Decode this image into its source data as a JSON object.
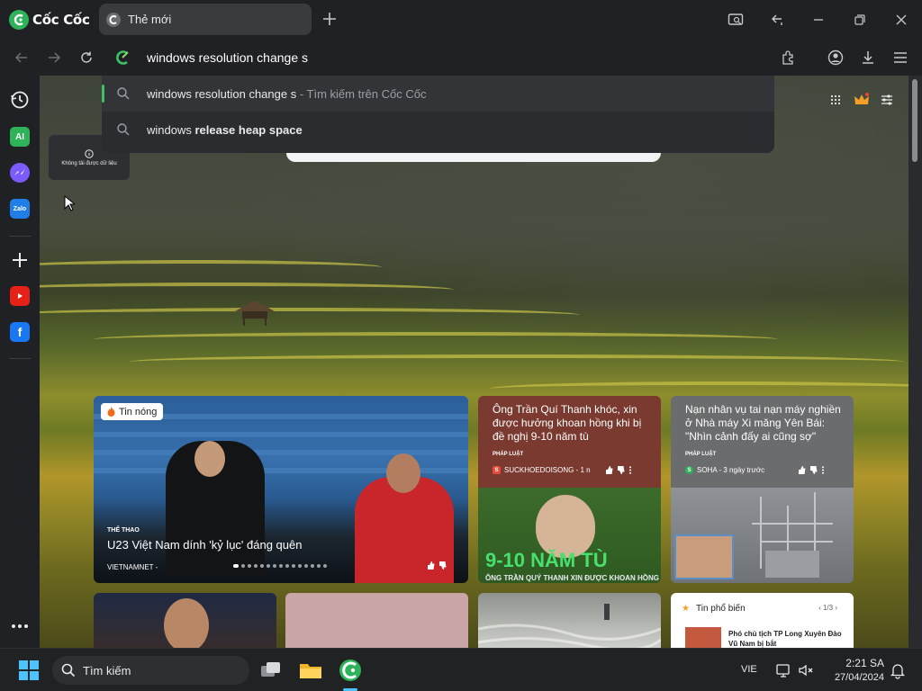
{
  "browser": {
    "name": "Cốc Cốc",
    "tab_title": "Thẻ mới",
    "address_text": "windows resolution change s"
  },
  "suggestions": [
    {
      "query": "windows resolution change s",
      "suffix": " - Tìm kiếm trên Cốc Cốc",
      "active": true
    },
    {
      "prefix": "windows ",
      "bold": "release heap space",
      "active": false
    }
  ],
  "sidebar": {
    "items": [
      "history-icon",
      "ai-icon",
      "messenger-icon",
      "zalo-icon",
      "add-icon",
      "youtube-icon",
      "facebook-icon",
      "more-icon"
    ]
  },
  "tooltip": {
    "text": "Không tải được dữ liệu"
  },
  "news": {
    "hero": {
      "badge": "Tin nóng",
      "category": "THỂ THAO",
      "title": "U23 Việt Nam dính 'kỷ lục' đáng quên",
      "source": "VIETNAMNET -"
    },
    "card2": {
      "title": "Ông Trần Quí Thanh khóc, xin được hưởng khoan hồng khi bị đề nghị 9-10 năm tù",
      "category": "PHÁP LUẬT",
      "source": "SUCKHOEDOISONG - 1 n",
      "image_caption": "9-10 NĂM TÙ",
      "image_sub": "ÔNG TRẦN QUÝ THANH XIN ĐƯỢC KHOAN HỒNG"
    },
    "card3": {
      "title": "Nạn nhân vụ tai nạn máy nghiền ở Nhà máy Xi măng Yên Bái: \"Nhìn cảnh đấy ai cũng sợ\"",
      "category": "PHÁP LUẬT",
      "source": "SOHA - 3 ngày trước"
    },
    "popular": {
      "title": "Tin phổ biến",
      "pager": "1/3",
      "item": "Phó chủ tịch TP Long Xuyên Đào Vũ Nam bị bắt"
    }
  },
  "taskbar": {
    "search_label": "Tìm kiếm",
    "language": "VIE",
    "time": "2:21 SA",
    "date": "27/04/2024"
  },
  "colors": {
    "accent_green": "#3ec065",
    "chrome_bg": "#202124"
  }
}
